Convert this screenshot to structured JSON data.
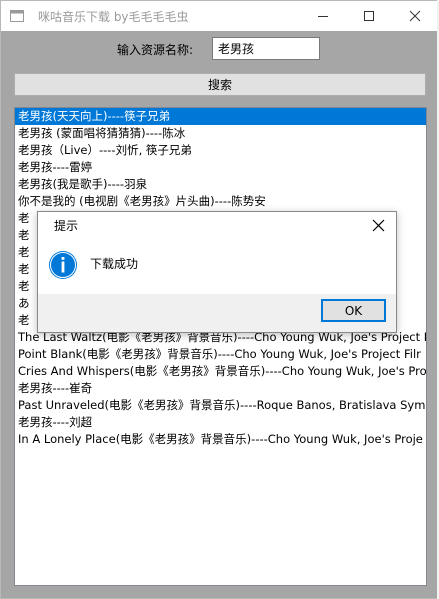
{
  "window": {
    "title": "咪咕音乐下载 by毛毛毛毛虫"
  },
  "form": {
    "label": "输入资源名称:",
    "search_value": "老男孩",
    "search_button": "搜索"
  },
  "results": [
    "老男孩(天天向上)----筷子兄弟",
    "老男孩 (蒙面唱将猜猜猜)----陈冰",
    "老男孩（Live）----刘忻, 筷子兄弟",
    "老男孩----雷婷",
    "老男孩(我是歌手)----羽泉",
    "你不是我的 (电视剧《老男孩》片头曲)----陈势安",
    "老",
    "老",
    "老",
    "老",
    "老",
    "あ",
    "老",
    "The Last Waltz(电影《老男孩》背景音乐)----Cho Young Wuk, Joe's Project F",
    "Point Blank(电影《老男孩》背景音乐)----Cho Young Wuk, Joe's Project Filr",
    "Cries And Whispers(电影《老男孩》背景音乐)----Cho Young Wuk, Joe's Pro",
    "老男孩----崔奇",
    "Past Unraveled(电影《老男孩》背景音乐)----Roque Banos, Bratislava Symp",
    "老男孩----刘超",
    "In A Lonely Place(电影《老男孩》背景音乐)----Cho Young Wuk, Joe's Proje"
  ],
  "selected_index": 0,
  "dialog": {
    "title": "提示",
    "message": "下载成功",
    "ok_label": "OK",
    "icon": "info-icon"
  },
  "colors": {
    "selection": "#0078d7",
    "info_icon": "#0078d7"
  }
}
